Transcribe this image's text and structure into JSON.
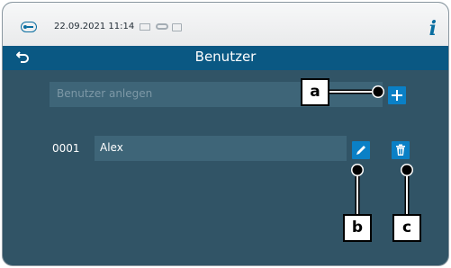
{
  "status_bar": {
    "datetime": "22.09.2021 11:14",
    "icons": [
      "lock-icon",
      "document-icon",
      "pipe-icon",
      "printer-icon",
      "info-icon"
    ],
    "info_label": "i"
  },
  "header": {
    "title": "Benutzer",
    "back_icon": "back-arrow-icon"
  },
  "user_create": {
    "placeholder": "Benutzer anlegen",
    "add_icon": "plus-icon"
  },
  "users": [
    {
      "id": "0001",
      "name": "Alex",
      "edit_icon": "pencil-icon",
      "delete_icon": "trash-icon"
    }
  ],
  "callouts": {
    "a": "a",
    "b": "b",
    "c": "c"
  },
  "colors": {
    "background": "#315466",
    "title_bar": "#0a5883",
    "field": "#3e6578",
    "accent": "#0a80c6",
    "status_bar": "#eceeef"
  }
}
